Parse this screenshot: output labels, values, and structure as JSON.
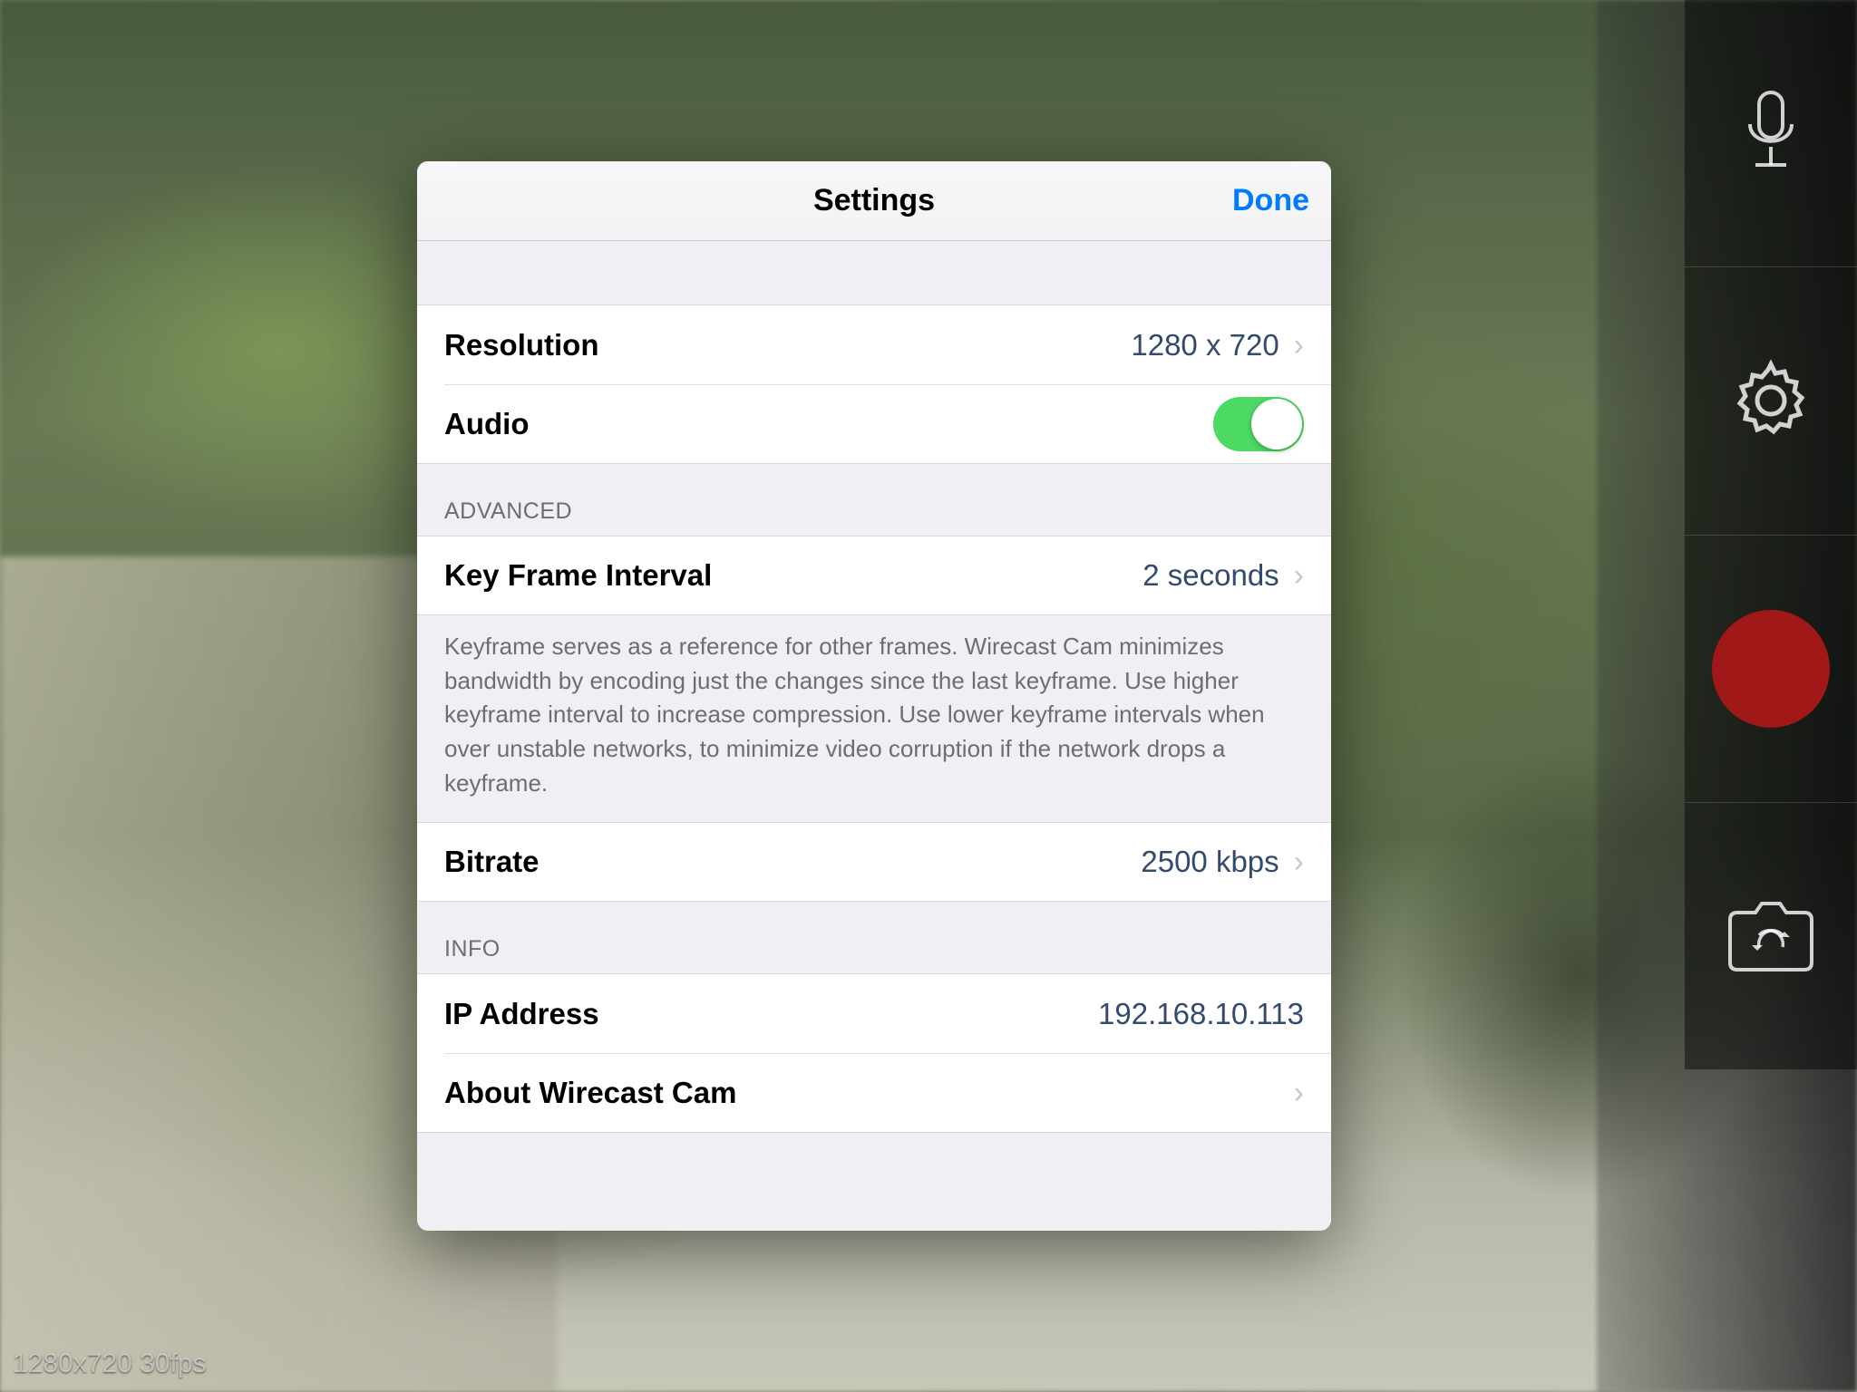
{
  "modal": {
    "title": "Settings",
    "done": "Done"
  },
  "settings": {
    "resolution_label": "Resolution",
    "resolution_value": "1280 x 720",
    "audio_label": "Audio",
    "audio_on": true
  },
  "advanced": {
    "header": "ADVANCED",
    "keyframe_label": "Key Frame Interval",
    "keyframe_value": "2 seconds",
    "keyframe_footer": "Keyframe serves as a reference for other frames. Wirecast Cam minimizes bandwidth by encoding just the changes since the last keyframe. Use higher keyframe interval to increase compression.  Use lower keyframe intervals when over unstable networks, to minimize video corruption if the network drops a keyframe.",
    "bitrate_label": "Bitrate",
    "bitrate_value": "2500 kbps"
  },
  "info": {
    "header": "INFO",
    "ip_label": "IP Address",
    "ip_value": "192.168.10.113",
    "about_label": "About Wirecast Cam"
  },
  "overlay": {
    "stat": "1280x720 30fps"
  }
}
